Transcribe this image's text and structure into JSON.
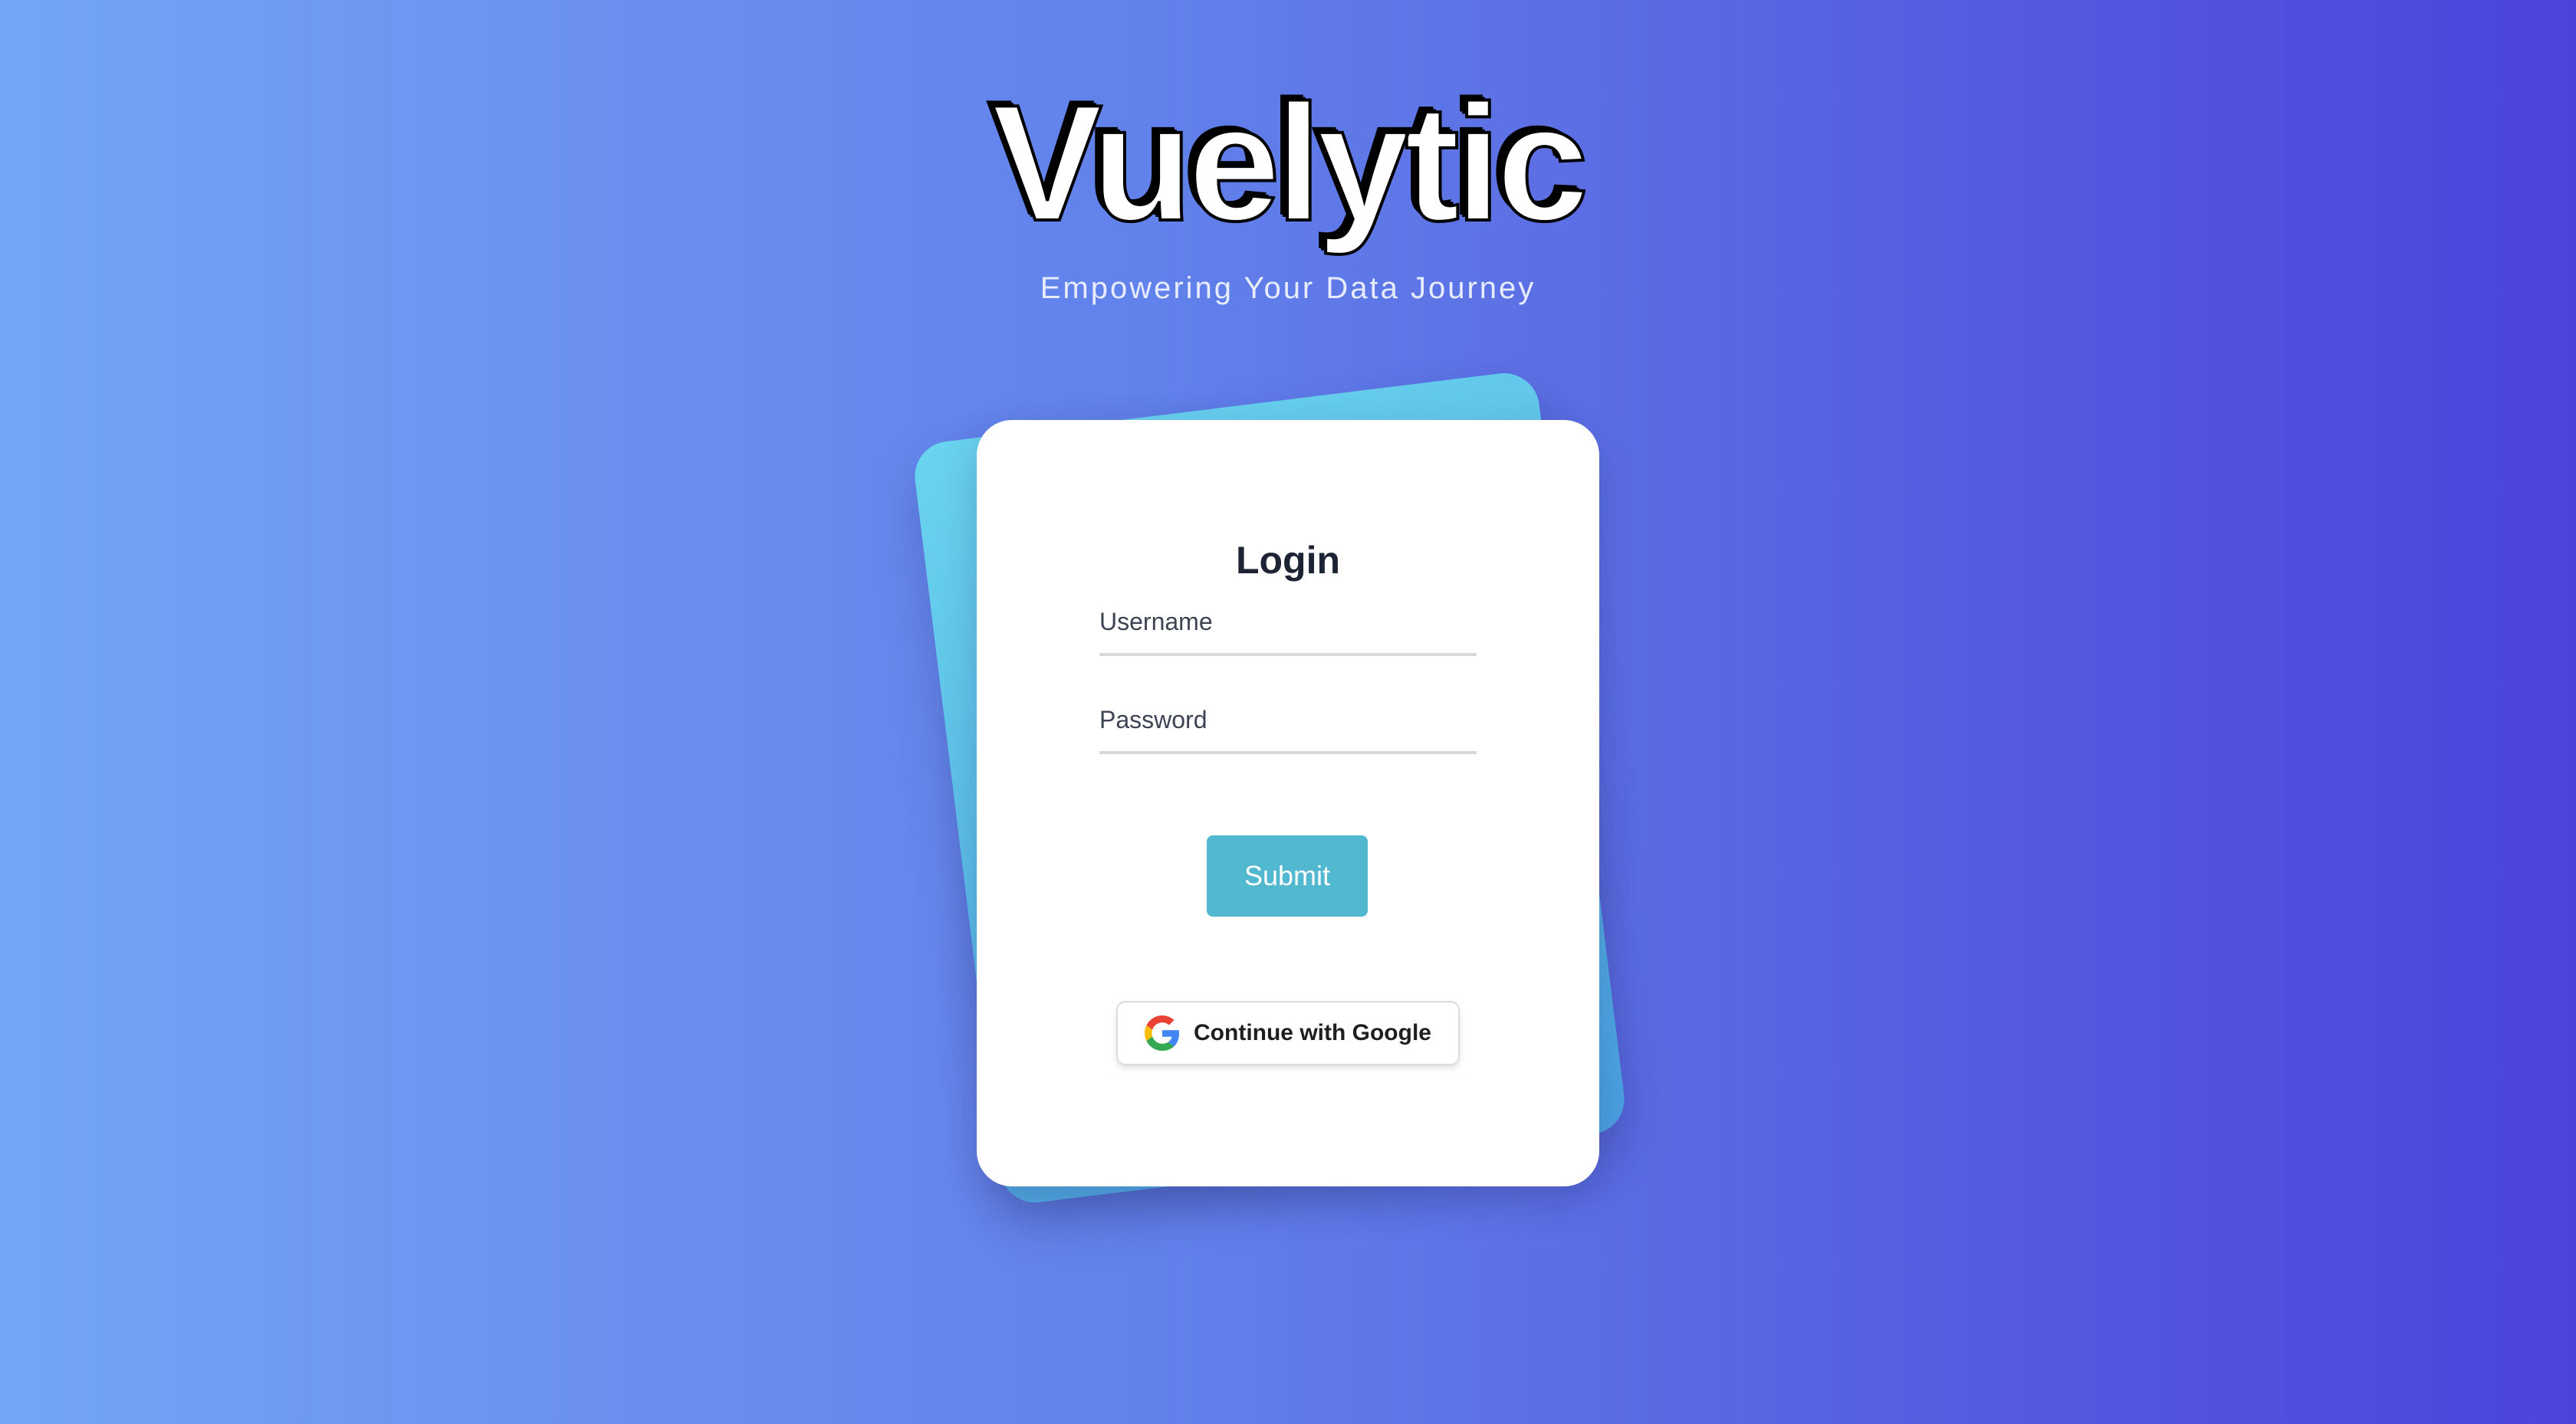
{
  "app": {
    "title": "Vuelytic",
    "tagline": "Empowering Your Data Journey"
  },
  "login": {
    "title": "Login",
    "username_placeholder": "Username",
    "password_placeholder": "Password",
    "submit_label": "Submit",
    "google_label": "Continue with Google",
    "google_icon": "google-g-icon"
  },
  "colors": {
    "background_start": "#74a5f4",
    "background_end": "#4b44dc",
    "card_background": "#ffffff",
    "accent_card": "#5bbde8",
    "submit_button": "#52b8cf"
  }
}
